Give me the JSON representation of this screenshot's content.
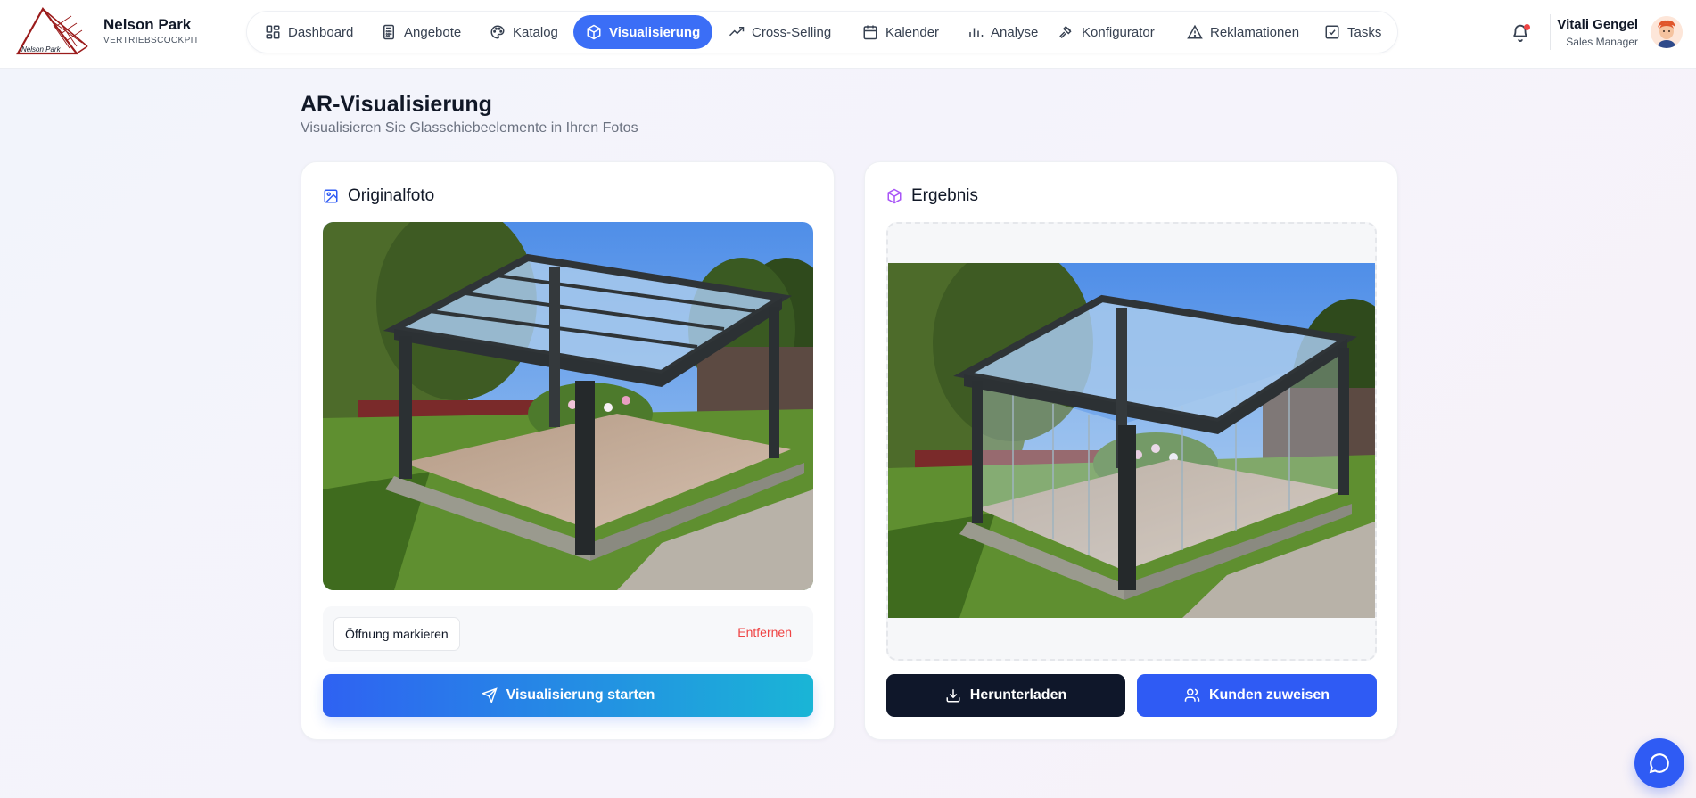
{
  "brand": {
    "name": "Nelson Park",
    "subtitle": "VERTRIEBSCOCKPIT",
    "logo_text": "Nelson Park"
  },
  "nav": {
    "items": [
      {
        "label": "Dashboard",
        "icon": "dashboard-icon"
      },
      {
        "label": "Angebote",
        "icon": "calculator-icon"
      },
      {
        "label": "Katalog",
        "icon": "palette-icon"
      },
      {
        "label": "Visualisierung",
        "icon": "cube-icon",
        "active": true
      },
      {
        "label": "Cross-Selling",
        "icon": "trending-up-icon"
      },
      {
        "label": "Kalender",
        "icon": "calendar-icon"
      },
      {
        "label": "Analyse",
        "icon": "bar-chart-icon"
      },
      {
        "label": "Konfigurator",
        "icon": "hammer-icon"
      },
      {
        "label": "Reklamationen",
        "icon": "warning-icon"
      },
      {
        "label": "Tasks",
        "icon": "checkbox-icon"
      }
    ]
  },
  "user": {
    "name": "Vitali Gengel",
    "role": "Sales Manager"
  },
  "page": {
    "title": "AR-Visualisierung",
    "subtitle": "Visualisieren Sie Glasschiebeelemente in Ihren Fotos"
  },
  "original": {
    "title": "Originalfoto",
    "mark_button": "Öffnung markieren",
    "remove_link": "Entfernen",
    "start_button": "Visualisierung starten"
  },
  "result": {
    "title": "Ergebnis",
    "download_button": "Herunterladen",
    "assign_button": "Kunden zuweisen"
  },
  "colors": {
    "accent": "#3b6ef6",
    "danger": "#ef4444",
    "dark_button": "#0f172a",
    "gradient_start": "#2f62f2",
    "gradient_end": "#1ab5d6"
  }
}
